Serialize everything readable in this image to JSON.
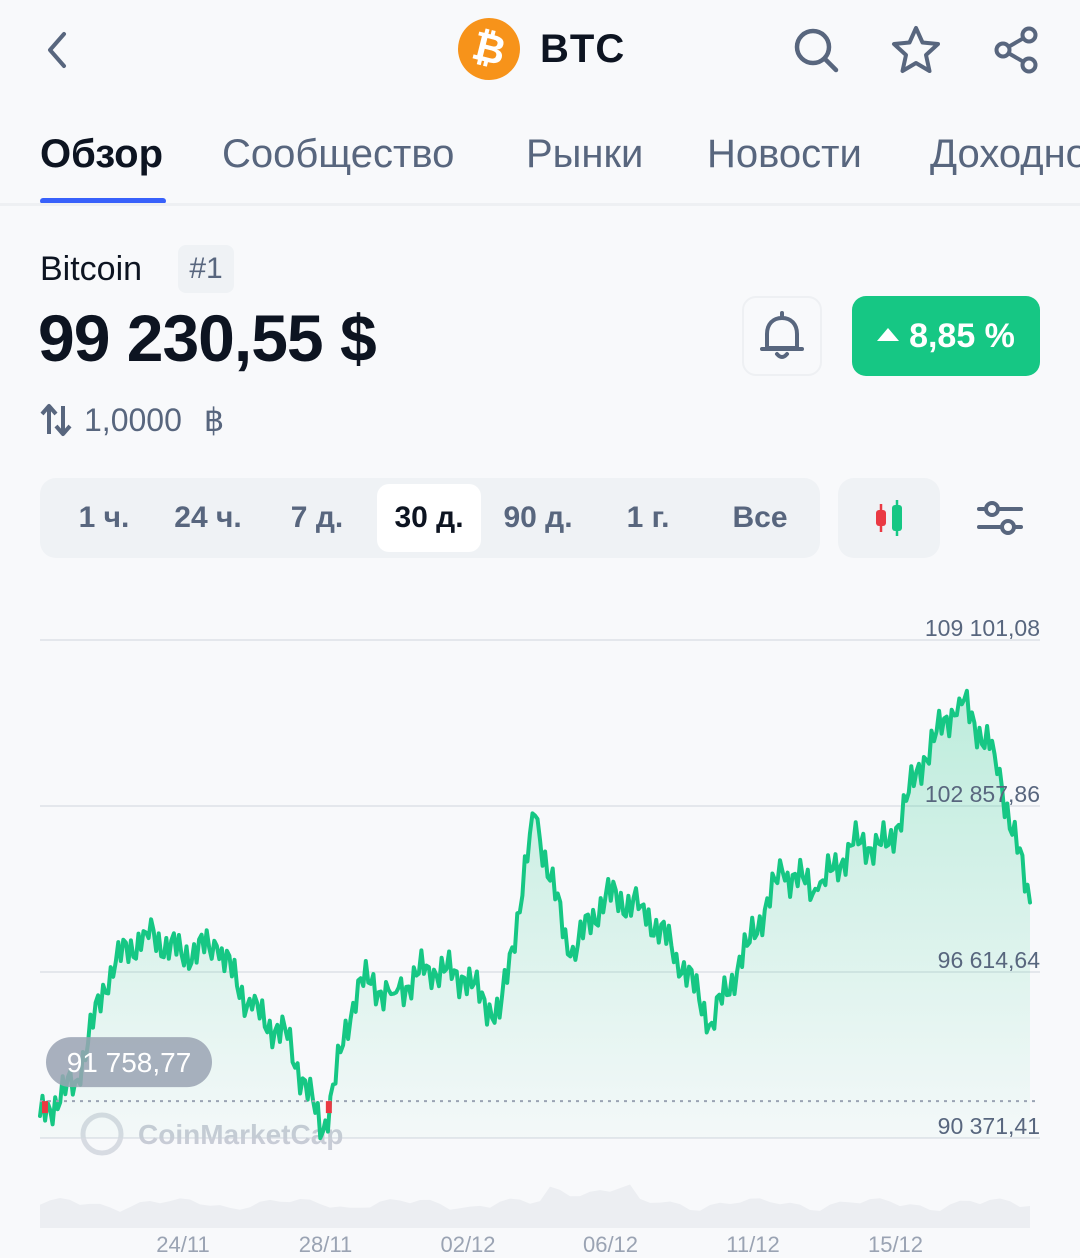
{
  "header": {
    "coin_logo_glyph": "₿",
    "symbol": "BTC",
    "icons": [
      "back-arrow-icon",
      "search-icon",
      "star-icon",
      "share-icon"
    ]
  },
  "tabs": [
    {
      "label": "Обзор",
      "active": true
    },
    {
      "label": "Сообщество",
      "active": false
    },
    {
      "label": "Рынки",
      "active": false
    },
    {
      "label": "Новости",
      "active": false
    },
    {
      "label": "Доходно",
      "active": false
    }
  ],
  "coin": {
    "name": "Bitcoin",
    "rank": "#1",
    "price": "99 230,55 $",
    "change": "8,85 %",
    "change_direction": "up",
    "conversion_value": "1,0000",
    "conversion_unit": "฿"
  },
  "ranges": [
    {
      "label": "1 ч.",
      "active": false
    },
    {
      "label": "24 ч.",
      "active": false
    },
    {
      "label": "7 д.",
      "active": false
    },
    {
      "label": "30 д.",
      "active": true
    },
    {
      "label": "90 д.",
      "active": false
    },
    {
      "label": "1 г.",
      "active": false
    },
    {
      "label": "Все",
      "active": false
    }
  ],
  "colors": {
    "accent": "#3861fb",
    "up": "#16c784",
    "down": "#ea3943",
    "text": "#0d1421",
    "muted": "#58667e"
  },
  "chart_data": {
    "type": "area",
    "x_tick_labels": [
      "24/11",
      "28/11",
      "02/12",
      "06/12",
      "11/12",
      "15/12"
    ],
    "y_tick_labels": [
      "109 101,08",
      "102 857,86",
      "96 614,64",
      "90 371,41"
    ],
    "ylim": [
      90371.41,
      109101.08
    ],
    "grid": true,
    "start_price_label": "91 758,77",
    "watermark": "CoinMarketCap",
    "series": [
      {
        "x": [
          "21/11",
          "22/11",
          "23/11",
          "24/11",
          "25/11",
          "26/11",
          "27/11",
          "28/11",
          "29/11",
          "30/11",
          "01/12",
          "02/12",
          "03/12",
          "04/12",
          "05/12",
          "06/12",
          "07/12",
          "08/12",
          "09/12",
          "10/12",
          "11/12",
          "12/12",
          "13/12",
          "14/12",
          "15/12",
          "16/12",
          "17/12",
          "18/12",
          "19/12"
        ],
        "values": [
          91200,
          92500,
          96800,
          98100,
          97300,
          97600,
          95200,
          94100,
          90600,
          96300,
          95800,
          96800,
          96400,
          94900,
          102500,
          97200,
          99500,
          99100,
          97300,
          94700,
          97600,
          100400,
          99700,
          101400,
          101400,
          104700,
          106900,
          104800,
          99230
        ]
      }
    ]
  }
}
